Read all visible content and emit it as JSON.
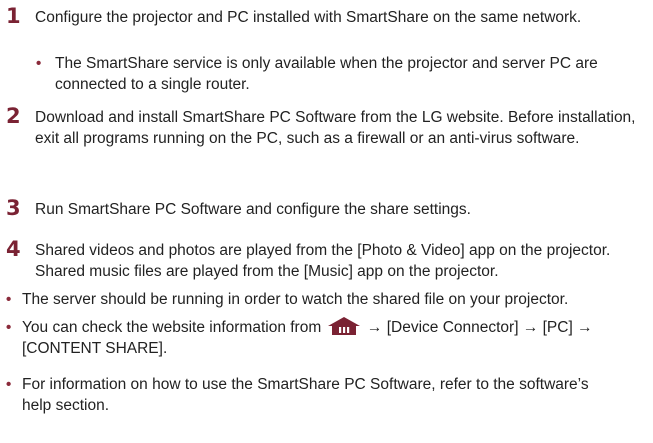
{
  "steps": [
    {
      "num": "1",
      "text": "Configure the projector and PC installed with SmartShare on the same network."
    },
    {
      "num": "2",
      "text": "Download and install SmartShare PC Software from the LG website. Before installation, exit all programs running on the PC, such as a firewall or an anti-virus software."
    },
    {
      "num": "3",
      "text": "Run SmartShare PC Software and configure the share settings."
    },
    {
      "num": "4",
      "text": "Shared videos and photos are played from the [Photo & Video] app on the projector. Shared music files are played from the [Music] app on the projector."
    }
  ],
  "step1_note": "The SmartShare service is only available when the projector and server PC are connected to a single router.",
  "notes": {
    "server": "The server should be running in order to watch the shared file on your projector.",
    "website_before": "You can check the website information from",
    "website_after": "→ [Device Connector] → [PC] → [CONTENT SHARE].",
    "help": "For information on how to use the SmartShare PC Software, refer to the software’s help section."
  },
  "icons": {
    "home": "home-icon",
    "bullet": "bullet-dot"
  },
  "colors": {
    "step_number": "#7a2233",
    "bullet": "#8a2a3a",
    "text": "#222222"
  }
}
